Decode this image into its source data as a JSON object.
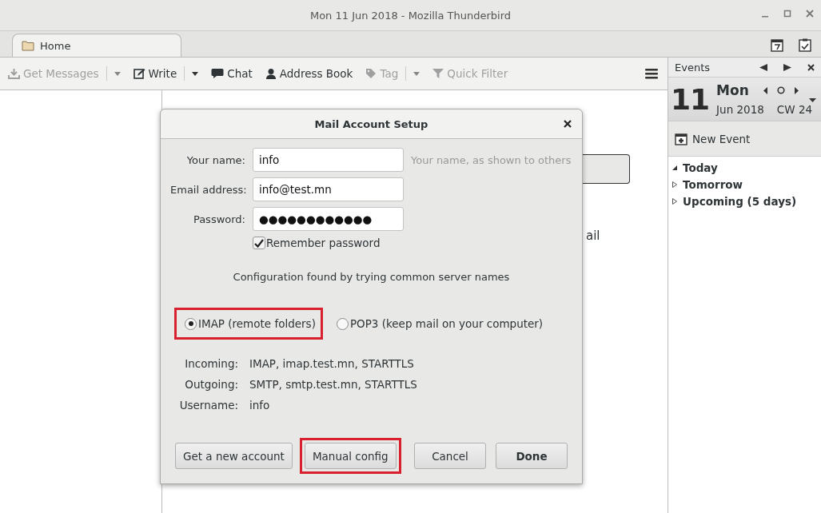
{
  "window": {
    "title": "Mon 11 Jun 2018 - Mozilla Thunderbird"
  },
  "tabs": [
    {
      "label": "Home",
      "selected": true
    }
  ],
  "toolbar": [
    {
      "label": "Get Messages",
      "kind": "get",
      "disabled": true,
      "dropdown": true
    },
    {
      "label": "Write",
      "kind": "write",
      "disabled": false,
      "dropdown": true
    },
    {
      "label": "Chat",
      "kind": "chat",
      "disabled": false,
      "dropdown": false
    },
    {
      "label": "Address Book",
      "kind": "contact",
      "disabled": false,
      "dropdown": false
    },
    {
      "label": "Tag",
      "kind": "tag",
      "disabled": true,
      "dropdown": true
    },
    {
      "label": "Quick Filter",
      "kind": "filter",
      "disabled": true,
      "dropdown": false
    }
  ],
  "background": {
    "text": "ail"
  },
  "events": {
    "title": "Events",
    "day": "11",
    "weekday": "Mon",
    "month": "Jun 2018",
    "week": "CW 24",
    "new_event": "New Event",
    "groups": [
      {
        "label": "Today",
        "expanded": true
      },
      {
        "label": "Tomorrow",
        "expanded": false
      },
      {
        "label": "Upcoming (5 days)",
        "expanded": false
      }
    ]
  },
  "dialog": {
    "title": "Mail Account Setup",
    "fields": [
      {
        "label": "Your name:",
        "value": "info",
        "hint": "Your name, as shown to others"
      },
      {
        "label": "Email address:",
        "value": "info@test.mn"
      },
      {
        "label": "Password:",
        "value": "●●●●●●●●●●●●"
      }
    ],
    "remember": {
      "label": "Remember password",
      "checked": true
    },
    "status": "Configuration found by trying common server names",
    "protocols": [
      {
        "label": "IMAP (remote folders)",
        "selected": true,
        "highlighted": true
      },
      {
        "label": "POP3 (keep mail on your computer)",
        "selected": false,
        "highlighted": false
      }
    ],
    "details": [
      {
        "label": "Incoming:",
        "value": "IMAP, imap.test.mn, STARTTLS"
      },
      {
        "label": "Outgoing:",
        "value": "SMTP, smtp.test.mn, STARTTLS"
      },
      {
        "label": "Username:",
        "value": "info"
      }
    ],
    "buttons": [
      {
        "label": "Get a new account",
        "kind": "left",
        "highlighted": false,
        "default": false
      },
      {
        "label": "Manual config",
        "kind": "left",
        "highlighted": true,
        "default": false
      },
      {
        "label": "Cancel",
        "kind": "right",
        "highlighted": false,
        "default": false
      },
      {
        "label": "Done",
        "kind": "right",
        "highlighted": false,
        "default": true
      }
    ]
  }
}
